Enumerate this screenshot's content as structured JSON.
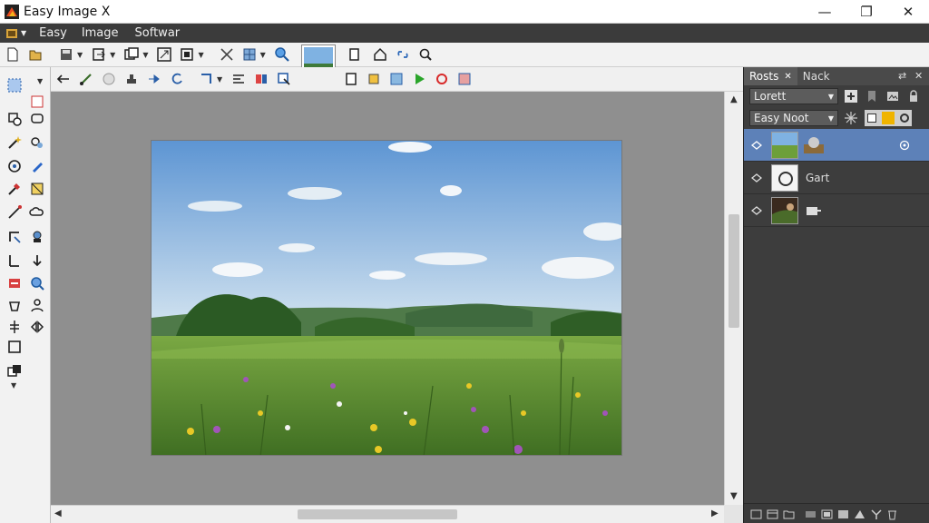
{
  "window": {
    "title": "Easy Image X",
    "minimize": "—",
    "maximize": "❐",
    "close": "✕"
  },
  "menu": {
    "items": [
      "Easy",
      "Image",
      "Softwar"
    ]
  },
  "layers_panel": {
    "tabs": [
      "Rosts",
      "Nack"
    ],
    "blend_mode": "Lorett",
    "preset": "Easy Noot",
    "layers": [
      {
        "name": "",
        "selected": true
      },
      {
        "name": "Gart",
        "selected": false
      },
      {
        "name": "",
        "selected": false
      }
    ]
  },
  "colors": {
    "accent": "#5d81b8",
    "menubar": "#3b3b3b",
    "panel": "#3d3d3d",
    "canvas": "#8f8f8f"
  }
}
